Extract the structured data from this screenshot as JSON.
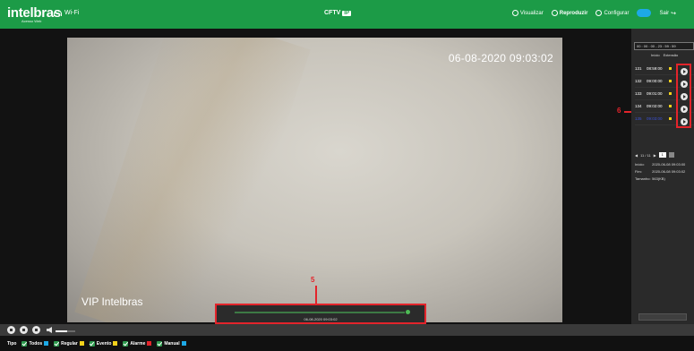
{
  "header": {
    "brand": "intelbras",
    "brand_sub": "Acesso Web",
    "wifi_label": "Wi-Fi",
    "product": "CFTV",
    "product_badge": "IP",
    "nav": [
      {
        "label": "Visualizar",
        "active": false
      },
      {
        "label": "Reproduzir",
        "active": true
      },
      {
        "label": "Configurar",
        "active": false
      }
    ],
    "logout_label": "Sair"
  },
  "video": {
    "timestamp": "06-08-2020 09:03:02",
    "camera_name": "VIP Intelbras",
    "timeline_time": "06-08-2020 09:03:02"
  },
  "annotations": {
    "timeline_marker": "5",
    "list_marker": "6"
  },
  "sidebar": {
    "time_range": "00 : 00 : 00 - 23 : 59 : 59",
    "col_start": "Início",
    "col_ext": "Extensão",
    "records": [
      {
        "index": "131",
        "time": "08:59:00",
        "selected": false
      },
      {
        "index": "132",
        "time": "09:00:00",
        "selected": false
      },
      {
        "index": "133",
        "time": "09:01:00",
        "selected": false
      },
      {
        "index": "134",
        "time": "09:02:00",
        "selected": false
      },
      {
        "index": "135",
        "time": "09:03:00",
        "selected": true
      }
    ],
    "pager": {
      "text": "11 / 11",
      "page_input": "1"
    },
    "meta": {
      "start_label": "Início:",
      "start_value": "2020-06-08 09:03:00",
      "end_label": "Fim:",
      "end_value": "2020-06-08 09:03:02",
      "size_label": "Tamanho:",
      "size_value": "563(KB)"
    }
  },
  "legend": {
    "type_label": "Tipo",
    "items": [
      {
        "label": "Todos",
        "color": "#1da9e6"
      },
      {
        "label": "Regular",
        "color": "#f2d11b"
      },
      {
        "label": "Evento",
        "color": "#f2d11b"
      },
      {
        "label": "Alarme",
        "color": "#e3242b"
      },
      {
        "label": "Manual",
        "color": "#1da9e6"
      }
    ]
  },
  "volume": {
    "level": 0.6
  }
}
